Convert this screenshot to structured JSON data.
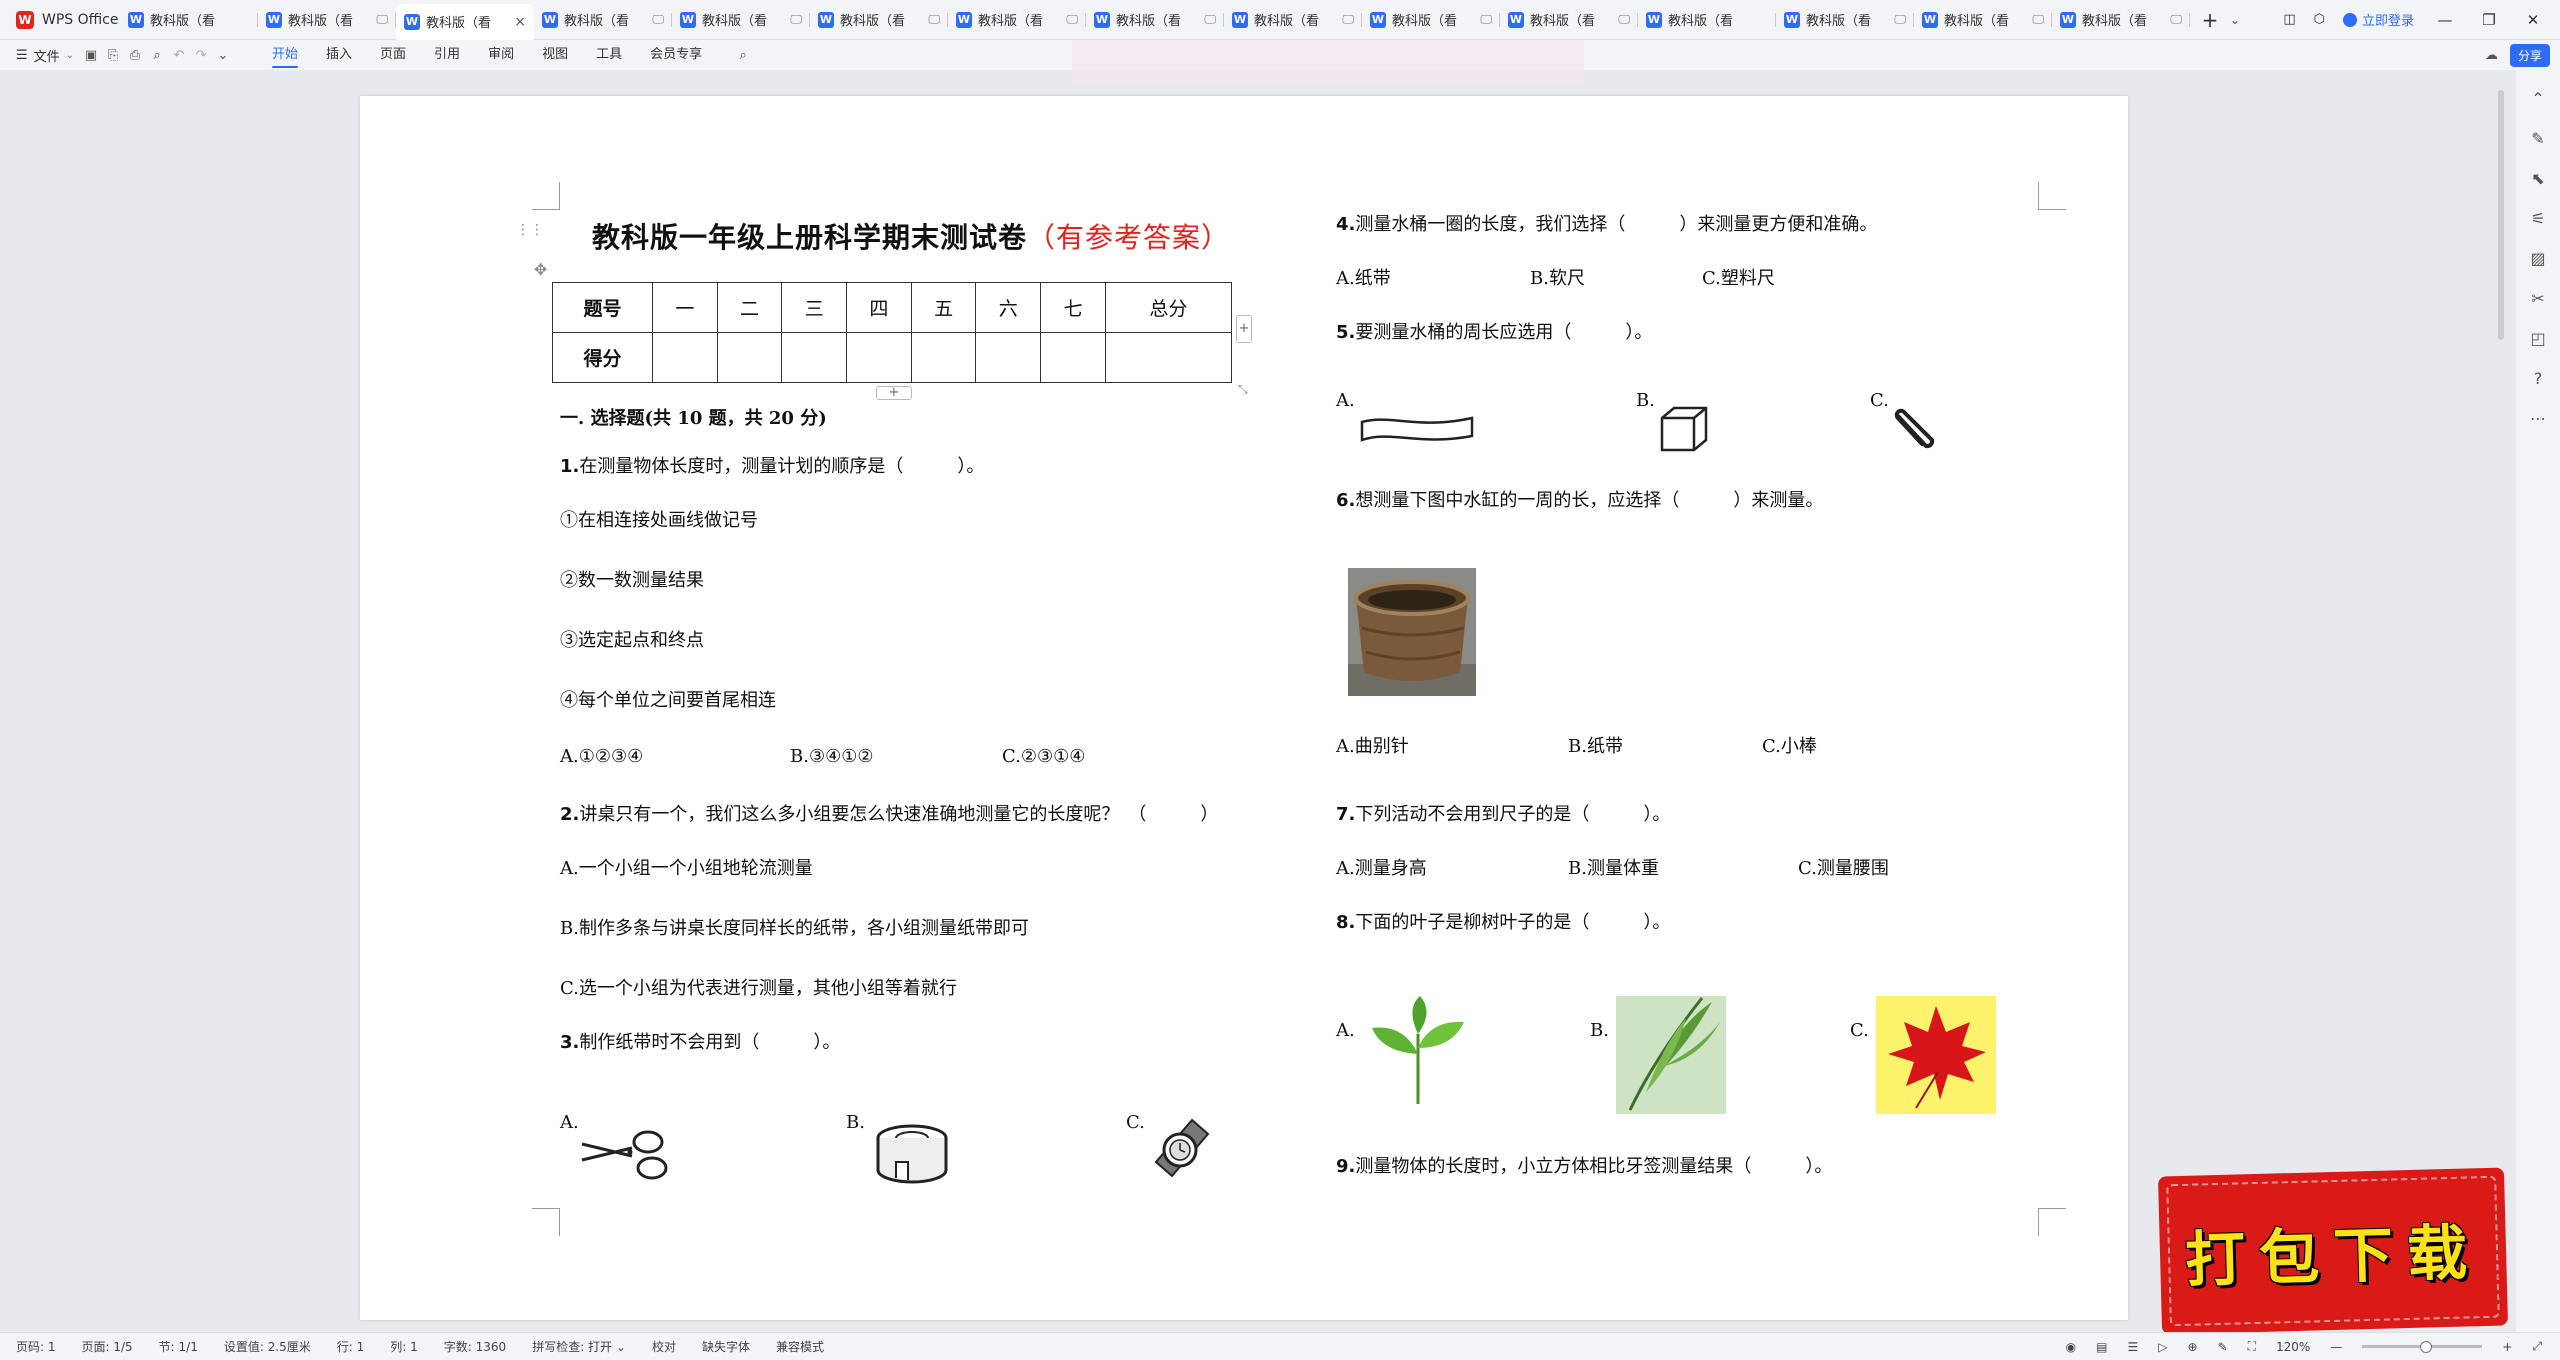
{
  "app": {
    "name": "WPS Office"
  },
  "tabs": [
    {
      "label": "教科版（看",
      "mini": "",
      "active": false
    },
    {
      "label": "教科版（看",
      "mini": "🖵",
      "active": false
    },
    {
      "label": "教科版（看",
      "mini": "🖵",
      "active": true
    },
    {
      "label": "教科版（看",
      "mini": "🖵",
      "active": false
    },
    {
      "label": "教科版（看",
      "mini": "🖵",
      "active": false
    },
    {
      "label": "教科版（看",
      "mini": "🖵",
      "active": false
    },
    {
      "label": "教科版（看",
      "mini": "🖵",
      "active": false
    },
    {
      "label": "教科版（看",
      "mini": "🖵",
      "active": false
    },
    {
      "label": "教科版（看",
      "mini": "🖵",
      "active": false
    },
    {
      "label": "教科版（看",
      "mini": "🖵",
      "active": false
    },
    {
      "label": "教科版（看",
      "mini": "🖵",
      "active": false
    },
    {
      "label": "教科版（看",
      "mini": "",
      "active": false
    },
    {
      "label": "教科版（看",
      "mini": "🖵",
      "active": false
    },
    {
      "label": "教科版（看",
      "mini": "🖵",
      "active": false
    },
    {
      "label": "教科版（看",
      "mini": "🖵",
      "active": false
    }
  ],
  "titlebar": {
    "login": "立即登录",
    "tab_close": "×",
    "tab_add": "+",
    "tab_more": "⌄"
  },
  "ribbon": {
    "file": "文件",
    "tabs": [
      "开始",
      "插入",
      "页面",
      "引用",
      "审阅",
      "视图",
      "工具",
      "会员专享"
    ],
    "active_tab": "开始",
    "share": "分享"
  },
  "doc": {
    "title": "教科版一年级上册科学期末测试卷",
    "title_note": "（有参考答案）",
    "score_table": {
      "header": [
        "题号",
        "一",
        "二",
        "三",
        "四",
        "五",
        "六",
        "七",
        "总分"
      ],
      "row2": [
        "得分",
        "",
        "",
        "",
        "",
        "",
        "",
        "",
        ""
      ]
    },
    "section1": "一. 选择题(共 10 题，共 20 分)",
    "q1": {
      "num": "1.",
      "text": "在测量物体长度时，测量计划的顺序是（　　　）。"
    },
    "q1_steps": [
      "①在相连接处画线做记号",
      "②数一数测量结果",
      "③选定起点和终点",
      "④每个单位之间要首尾相连"
    ],
    "q1_opts": [
      "A.①②③④",
      "B.③④①②",
      "C.②③①④"
    ],
    "q2": {
      "num": "2.",
      "text": "讲桌只有一个，我们这么多小组要怎么快速准确地测量它的长度呢？　（　　　）"
    },
    "q2_opts": [
      "A.一个小组一个小组地轮流测量",
      "B.制作多条与讲桌长度同样长的纸带，各小组测量纸带即可",
      "C.选一个小组为代表进行测量，其他小组等着就行"
    ],
    "q3": {
      "num": "3.",
      "text": "制作纸带时不会用到（　　　）。"
    },
    "q3_labels": [
      "A.",
      "B.",
      "C."
    ],
    "q4": {
      "num": "4.",
      "text": "测量水桶一圈的长度，我们选择（　　　）来测量更方便和准确。"
    },
    "q4_opts": [
      "A.纸带",
      "B.软尺",
      "C.塑料尺"
    ],
    "q5": {
      "num": "5.",
      "text": "要测量水桶的周长应选用（　　　）。"
    },
    "q5_labels": [
      "A.",
      "B.",
      "C."
    ],
    "q6": {
      "num": "6.",
      "text": "想测量下图中水缸的一周的长，应选择（　　　）来测量。"
    },
    "q6_opts": [
      "A.曲别针",
      "B.纸带",
      "C.小棒"
    ],
    "q7": {
      "num": "7.",
      "text": "下列活动不会用到尺子的是（　　　）。"
    },
    "q7_opts": [
      "A.测量身高",
      "B.测量体重",
      "C.测量腰围"
    ],
    "q8": {
      "num": "8.",
      "text": "下面的叶子是柳树叶子的是（　　　）。"
    },
    "q8_labels": [
      "A.",
      "B.",
      "C."
    ],
    "q9": {
      "num": "9.",
      "text": "测量物体的长度时，小立方体相比牙签测量结果（　　　）。"
    }
  },
  "badge": {
    "text": "打包下载"
  },
  "status": {
    "items": [
      "页码: 1",
      "页面: 1/5",
      "节: 1/1",
      "设置值: 2.5厘米",
      "行: 1",
      "列: 1",
      "字数: 1360",
      "拼写检查: 打开 ⌄",
      "校对",
      "缺失字体",
      "兼容模式"
    ],
    "zoom": "120%"
  },
  "colors": {
    "accent": "#2f6cf6",
    "title_red": "#e2231a",
    "badge_red": "#d91a17",
    "badge_text": "#ffe11a"
  }
}
